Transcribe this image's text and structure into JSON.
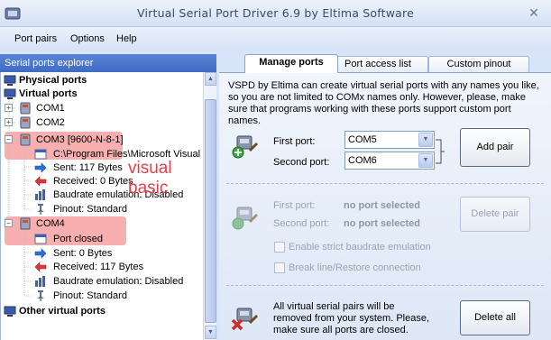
{
  "window": {
    "title": "Virtual Serial Port Driver 6.9 by Eltima Software",
    "close_glyph": "✕"
  },
  "menu": {
    "items": [
      "Port pairs",
      "Options",
      "Help"
    ]
  },
  "explorer": {
    "header": "Serial ports explorer",
    "physical_ports": "Physical ports",
    "virtual_ports": "Virtual ports",
    "com1": "COM1",
    "com2": "COM2",
    "com3": {
      "label": "COM3 [9600-N-8-1]",
      "app": "C:\\Program Files\\Microsoft Visual S",
      "sent": "Sent: 117 Bytes",
      "received": "Received: 0 Bytes",
      "baudrate": "Baudrate emulation: Disabled",
      "pinout": "Pinout: Standard"
    },
    "com4": {
      "label": "COM4",
      "status": "Port closed",
      "sent": "Sent: 0 Bytes",
      "received": "Received: 117 Bytes",
      "baudrate": "Baudrate emulation: Disabled",
      "pinout": "Pinout: Standard"
    },
    "other_virtual_ports": "Other virtual ports",
    "annotation": "visual basic"
  },
  "tabs": [
    "Manage ports",
    "Port access list",
    "Custom pinout"
  ],
  "manage": {
    "description": "VSPD by Eltima can create virtual serial ports with any names you like, so you are not limited to COMx names only. However, please, make sure that programs working with these ports support custom port names.",
    "add": {
      "first_port_label": "First port:",
      "first_port_value": "COM5",
      "second_port_label": "Second port:",
      "second_port_value": "COM6",
      "button": "Add pair"
    },
    "delete": {
      "first_port_label": "First port:",
      "first_port_value": "no port selected",
      "second_port_label": "Second port:",
      "second_port_value": "no port selected",
      "button": "Delete pair",
      "strict_baudrate": "Enable strict baudrate emulation",
      "break_line": "Break line/Restore connection"
    },
    "delete_all": {
      "text": "All virtual serial pairs will be removed from your system. Please, make sure all ports are closed.",
      "button": "Delete all"
    }
  },
  "colors": {
    "accent": "#3f6bc4",
    "highlight": "#f07070",
    "annotation": "#e2404a"
  }
}
